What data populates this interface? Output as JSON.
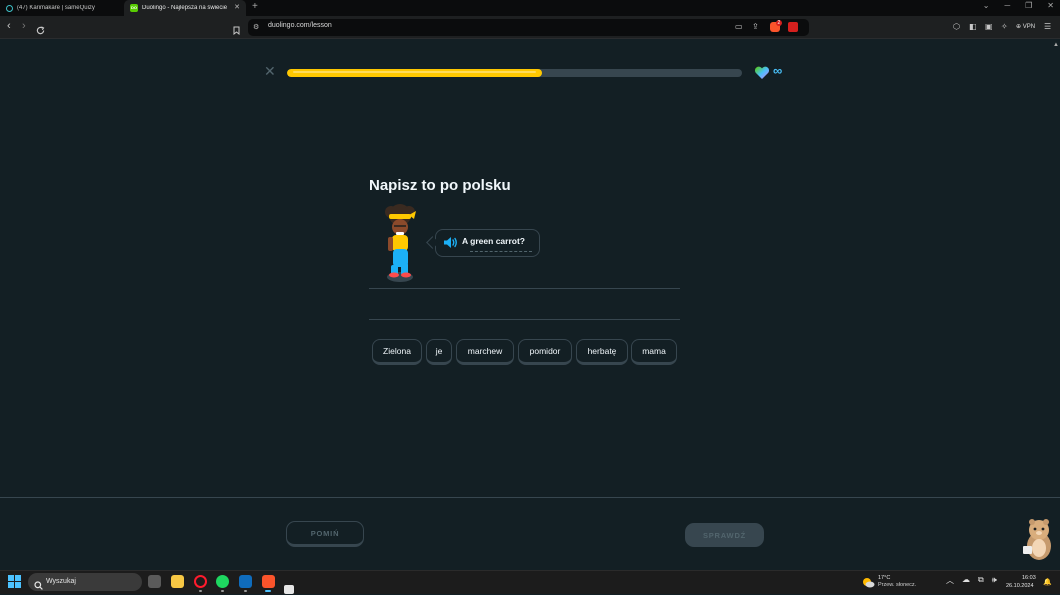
{
  "browser": {
    "tabs": [
      {
        "title": "(47) Karimakare | sameQuizy",
        "active": false
      },
      {
        "title": "Duolingo - Najlepsza na świecie",
        "active": true,
        "favicon_text": "DO"
      }
    ],
    "url": "duolingo.com/lesson",
    "vpn_label": "VPN",
    "brave_badge_count": "2"
  },
  "lesson": {
    "progress": 0.56,
    "hearts": "∞",
    "title": "Napisz to po polsku",
    "prompt": "A green carrot?",
    "word_bank": [
      "Zielona",
      "je",
      "marchew",
      "pomidor",
      "herbatę",
      "mama"
    ],
    "skip_label": "POMIŃ",
    "check_label": "SPRAWDŹ"
  },
  "colors": {
    "background": "#131f24",
    "border": "#37464f",
    "progress": "#ffc800",
    "heart_gem": "#49c0f8",
    "muted": "#52656d"
  },
  "taskbar": {
    "search_placeholder": "Wyszukaj",
    "weather_temp": "17°C",
    "weather_desc": "Przew. słonecz.",
    "time": "16:03",
    "date": "26.10.2024"
  }
}
